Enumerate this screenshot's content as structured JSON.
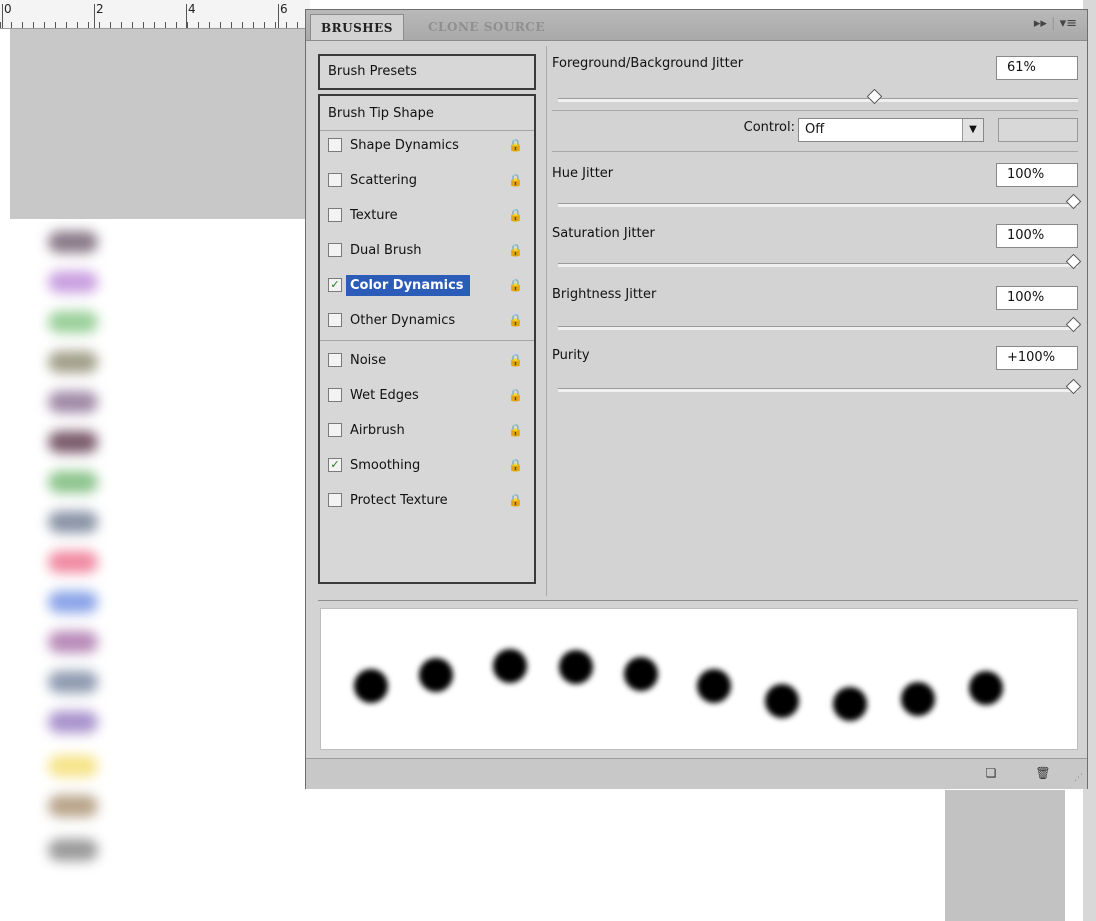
{
  "ruler": {
    "numbers": [
      "0",
      "2",
      "4",
      "6"
    ]
  },
  "panel": {
    "tabs": [
      {
        "label": "BRUSHES",
        "active": true
      },
      {
        "label": "CLONE SOURCE",
        "active": false
      }
    ],
    "tab_icons": {
      "collapse": "▸▸",
      "menu": "▾≡"
    },
    "presets_button": "Brush Presets",
    "list_header": "Brush Tip Shape",
    "options": [
      {
        "label": "Shape Dynamics",
        "checked": false
      },
      {
        "label": "Scattering",
        "checked": false
      },
      {
        "label": "Texture",
        "checked": false
      },
      {
        "label": "Dual Brush",
        "checked": false
      },
      {
        "label": "Color Dynamics",
        "checked": true,
        "selected": true
      },
      {
        "label": "Other Dynamics",
        "checked": false
      },
      {
        "label": "Noise",
        "checked": false
      },
      {
        "label": "Wet Edges",
        "checked": false
      },
      {
        "label": "Airbrush",
        "checked": false
      },
      {
        "label": "Smoothing",
        "checked": true
      },
      {
        "label": "Protect Texture",
        "checked": false
      }
    ],
    "settings": {
      "fg_bg_jitter": {
        "label": "Foreground/Background Jitter",
        "value": "61%",
        "fraction": 0.61
      },
      "control": {
        "label": "Control:",
        "value": "Off"
      },
      "hue_jitter": {
        "label": "Hue Jitter",
        "value": "100%",
        "fraction": 1.0
      },
      "saturation_jitter": {
        "label": "Saturation Jitter",
        "value": "100%",
        "fraction": 1.0
      },
      "brightness_jitter": {
        "label": "Brightness Jitter",
        "value": "100%",
        "fraction": 1.0
      },
      "purity": {
        "label": "Purity",
        "value": "+100%",
        "fraction": 1.0
      }
    },
    "icons": {
      "check": "✓",
      "lock": "🔒",
      "new_brush": "❏",
      "delete": "🗑",
      "grip": "⋰"
    },
    "colors": {
      "selection": "#2a5cb8",
      "panel_bg": "#d3d3d3",
      "tab_inactive": "#8f8f8f"
    }
  }
}
